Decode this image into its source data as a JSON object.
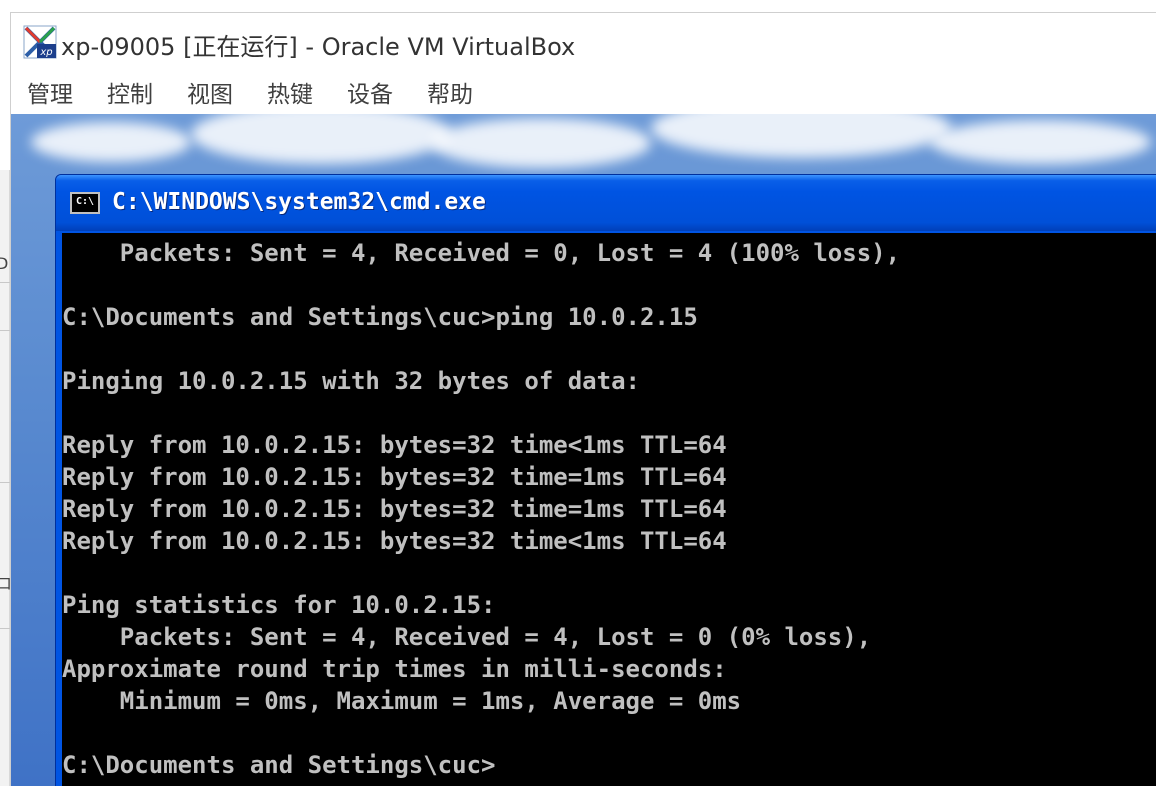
{
  "window": {
    "title": "xp-09005 [正在运行] - Oracle VM VirtualBox",
    "icon": "virtualbox-xp-icon"
  },
  "menubar": {
    "items": [
      {
        "label": "管理"
      },
      {
        "label": "控制"
      },
      {
        "label": "视图"
      },
      {
        "label": "热键"
      },
      {
        "label": "设备"
      },
      {
        "label": "帮助"
      }
    ]
  },
  "host_strip": {
    "glyph_top": "D",
    "glyph_bottom": "ロ"
  },
  "cmd": {
    "title": "C:\\WINDOWS\\system32\\cmd.exe",
    "icon_label": "C:\\",
    "lines": [
      "    Packets: Sent = 4, Received = 0, Lost = 4 (100% loss),",
      "",
      "C:\\Documents and Settings\\cuc>ping 10.0.2.15",
      "",
      "Pinging 10.0.2.15 with 32 bytes of data:",
      "",
      "Reply from 10.0.2.15: bytes=32 time<1ms TTL=64",
      "Reply from 10.0.2.15: bytes=32 time=1ms TTL=64",
      "Reply from 10.0.2.15: bytes=32 time=1ms TTL=64",
      "Reply from 10.0.2.15: bytes=32 time<1ms TTL=64",
      "",
      "Ping statistics for 10.0.2.15:",
      "    Packets: Sent = 4, Received = 4, Lost = 0 (0% loss),",
      "Approximate round trip times in milli-seconds:",
      "    Minimum = 0ms, Maximum = 1ms, Average = 0ms",
      "",
      "C:\\Documents and Settings\\cuc>"
    ]
  },
  "colors": {
    "console_bg": "#000000",
    "console_text": "#c0c0c0",
    "xp_title_blue": "#0054e3"
  }
}
